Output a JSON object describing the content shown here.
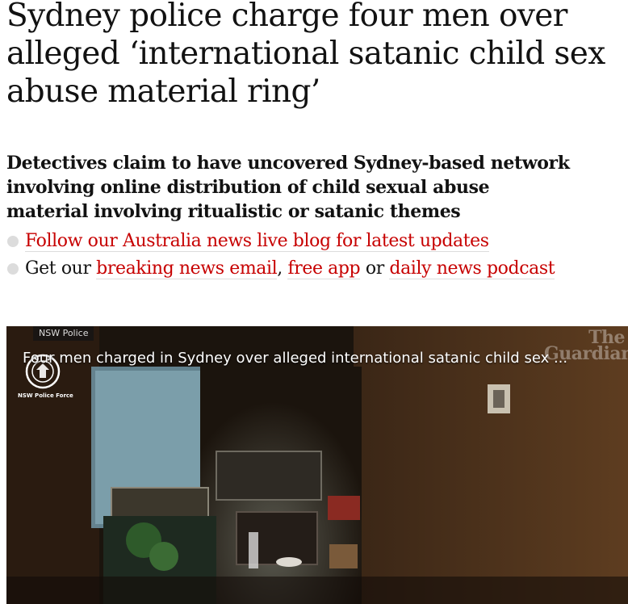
{
  "article": {
    "headline": "Sydney police charge four men over alleged ‘international satanic child sex abuse material ring’",
    "standfirst": "Detectives claim to have uncovered Sydney-based network involving online distribution of child sexual abuse material involving ritualistic or satanic themes",
    "bullets": [
      {
        "link_text": "Follow our Australia news live blog for latest updates"
      },
      {
        "prefix": "Get our ",
        "link1": "breaking news email",
        "sep1": ", ",
        "link2": "free app",
        "sep2": " or ",
        "link3": "daily news podcast"
      }
    ]
  },
  "video": {
    "channel": "NSW Police",
    "title": "Four men charged in Sydney over alleged international satanic child sex ...",
    "logo_text": "NSW Police Force",
    "watermark_line1": "The",
    "watermark_line2": "Guardian"
  },
  "colors": {
    "link": "#c70000",
    "text": "#121212",
    "bullet_dot": "#dcdcdc"
  }
}
